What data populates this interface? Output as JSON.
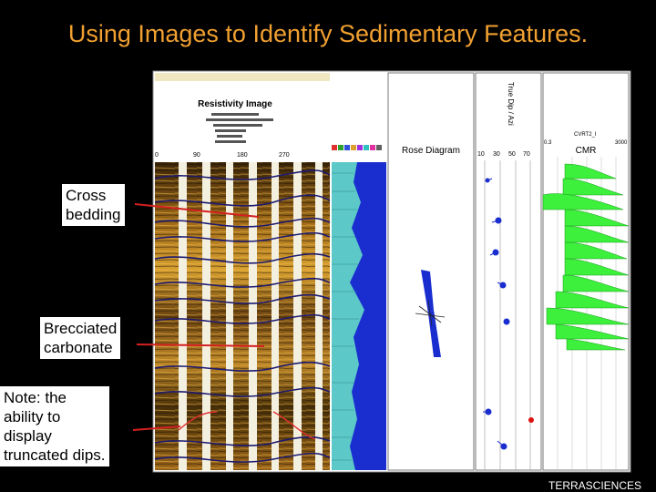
{
  "slide": {
    "title": "Using Images to Identify Sedimentary Features.",
    "credit": "TERRASCIENCES"
  },
  "callouts": [
    {
      "text": "Cross\nbedding",
      "color": "#d42020"
    },
    {
      "text": "Brecciated\ncarbonate",
      "color": "#d42020"
    },
    {
      "text": "Note: the\nability to\ndisplay\ntruncated dips.",
      "color": "#d42020"
    }
  ],
  "log_panel": {
    "resistivity_title": "Resistivity Image",
    "resistivity_ticks": [
      "0",
      "90",
      "180",
      "270"
    ],
    "rose_title": "Rose Diagram",
    "dip_axis_ticks": [
      "10",
      "30",
      "50",
      "70"
    ],
    "dip_track_label": "True Dip / Azi",
    "cmr_title": "CMR",
    "cmr_curve": "CVRT2_I",
    "cmr_range": [
      "0.3",
      "3000"
    ]
  },
  "colors": {
    "title": "#f0a030",
    "background": "#000000",
    "blue_track": "#1a2ecf",
    "cyan_bars": "#5cc8c8",
    "cmr_green": "#3cf03c",
    "tadpole": "#1a2ecf",
    "tadpole_highlight": "#e01010"
  }
}
